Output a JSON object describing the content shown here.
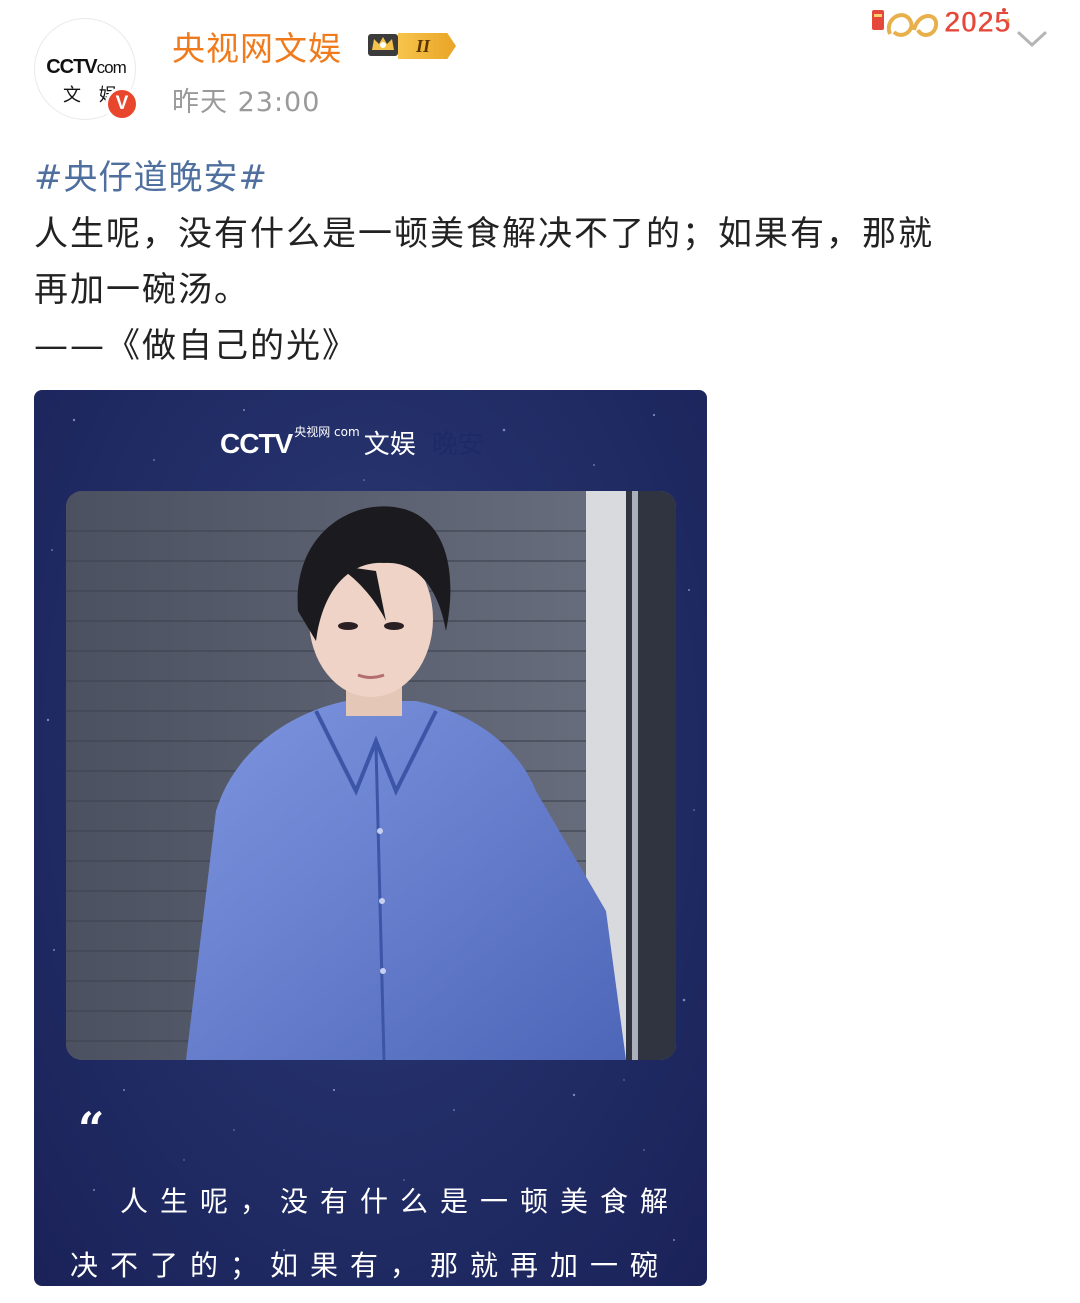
{
  "header": {
    "avatar_logo_text": "CCTV",
    "avatar_logo_com": "com",
    "avatar_logo_sub": "文 娱",
    "verified_mark": "V",
    "username": "央视网文娱",
    "rank_badge": "II",
    "timestamp": "昨天 23:00",
    "year_decoration": "2025"
  },
  "post": {
    "hashtag": "#央仔道晚安#",
    "lines": [
      "人生呢，没有什么是一顿美食解决不了的；如果有，那就",
      "再加一碗汤。",
      "——《做自己的光》"
    ]
  },
  "card": {
    "logo_cctv": "CCTV",
    "logo_small": "央视网 com",
    "logo_wenyu": "文娱",
    "logo_wanan": "晚安",
    "quote_mark": "“",
    "quote_lines": [
      "人生呢，没有什么是一顿美食解",
      "决不了的；如果有，那就再加一碗"
    ]
  },
  "icons": {
    "crown": "crown-icon",
    "chevron": "chevron-down-icon",
    "verified": "verified-icon"
  },
  "colors": {
    "username": "#f07b1c",
    "hashtag": "#4f6f9f",
    "verified": "#e8472e",
    "card_background": "#24306a"
  }
}
